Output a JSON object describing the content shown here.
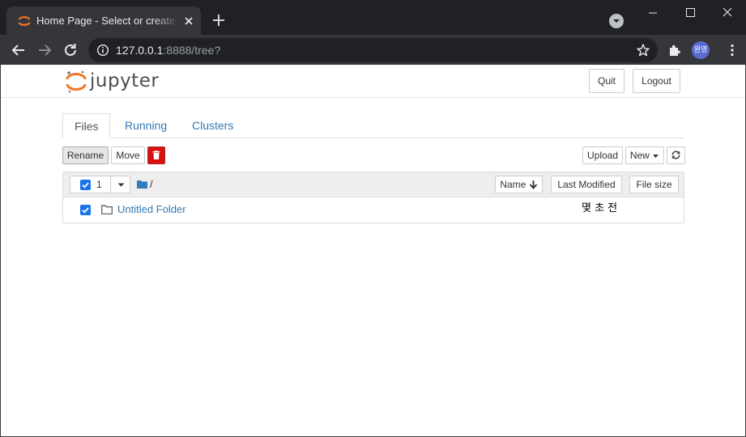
{
  "browser": {
    "tab_title": "Home Page - Select or create a notebook",
    "url_host": "127.0.0.1",
    "url_rest": ":8888/tree?",
    "profile_initials": "원영",
    "icons": [
      "jupyter-favicon",
      "close-icon",
      "plus-icon",
      "profile-dropdown-icon",
      "minimize-icon",
      "maximize-icon",
      "window-close-icon",
      "back-arrow-icon",
      "forward-arrow-icon",
      "reload-icon",
      "info-icon",
      "star-icon",
      "puzzle-icon",
      "more-menu-icon"
    ]
  },
  "header": {
    "logo_text": "jupyter",
    "quit_label": "Quit",
    "logout_label": "Logout"
  },
  "tabs": [
    {
      "label": "Files",
      "active": true
    },
    {
      "label": "Running",
      "active": false
    },
    {
      "label": "Clusters",
      "active": false
    }
  ],
  "actions": {
    "rename_label": "Rename",
    "move_label": "Move",
    "upload_label": "Upload",
    "new_label": "New",
    "delete_icon": "trash-icon",
    "refresh_icon": "refresh-icon"
  },
  "list": {
    "selected_count": "1",
    "breadcrumb": "/",
    "col_name": "Name",
    "col_last_modified": "Last Modified",
    "col_file_size": "File size",
    "rows": [
      {
        "name": "Untitled Folder",
        "last_modified": "몇 초 전",
        "checked": true,
        "type": "folder"
      }
    ]
  },
  "colors": {
    "chrome_dark": "#202124",
    "chrome_tab": "#35363a",
    "link_blue": "#337ab7",
    "checkbox_blue": "#1a73e8",
    "delete_red": "#d9100e",
    "jupyter_orange": "#f37626"
  }
}
